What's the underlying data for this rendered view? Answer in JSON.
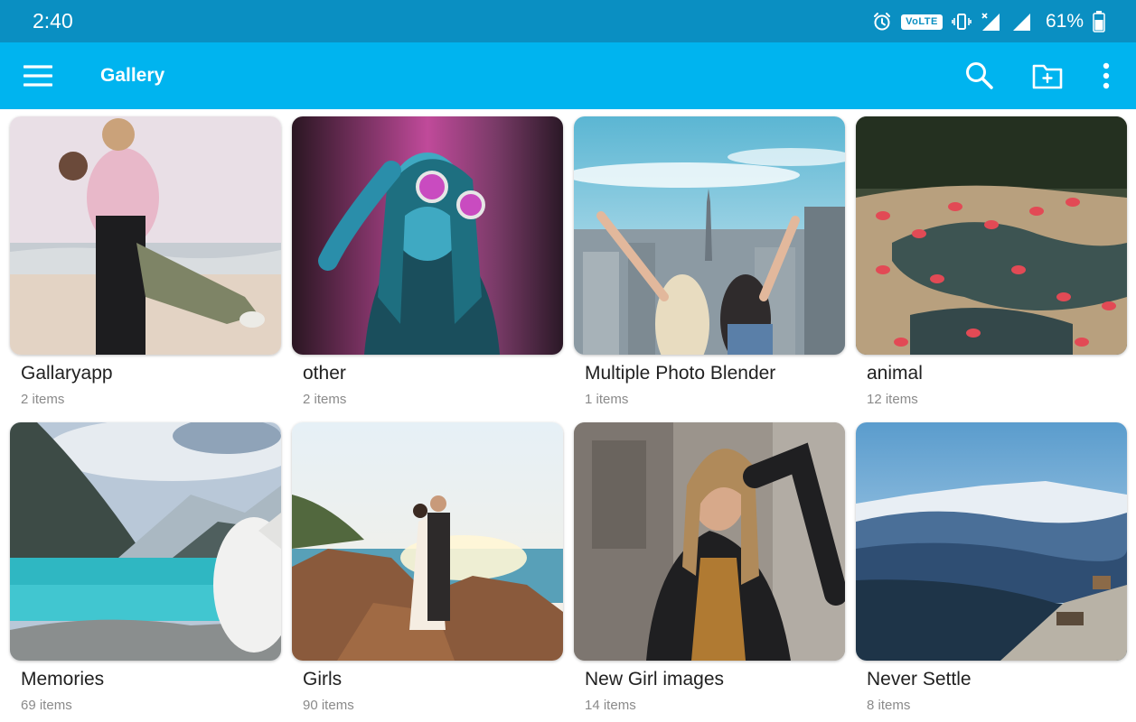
{
  "status_bar": {
    "time": "2:40",
    "network_badge": "VoLTE",
    "battery": "61%",
    "icons": [
      "alarm-icon",
      "volte-icon",
      "vibrate-icon",
      "signal-x-icon",
      "signal-icon",
      "battery-icon"
    ]
  },
  "app_bar": {
    "title": "Gallery",
    "icons": [
      "menu-icon",
      "search-icon",
      "new-folder-icon",
      "more-vert-icon"
    ],
    "background": "#00b4ef"
  },
  "colors": {
    "status_bar": "#0a8fc2",
    "app_bar": "#00b4ef",
    "album_name": "#212121",
    "album_count": "#8a8a8a"
  },
  "albums": [
    {
      "name": "Gallaryapp",
      "count": "2 items"
    },
    {
      "name": "other",
      "count": "2 items"
    },
    {
      "name": "Multiple Photo Blender",
      "count": "1 items"
    },
    {
      "name": "animal",
      "count": "12 items"
    },
    {
      "name": "Memories",
      "count": "69 items"
    },
    {
      "name": "Girls",
      "count": "90 items"
    },
    {
      "name": "New Girl images",
      "count": "14 items"
    },
    {
      "name": "Never Settle",
      "count": "8 items"
    }
  ]
}
